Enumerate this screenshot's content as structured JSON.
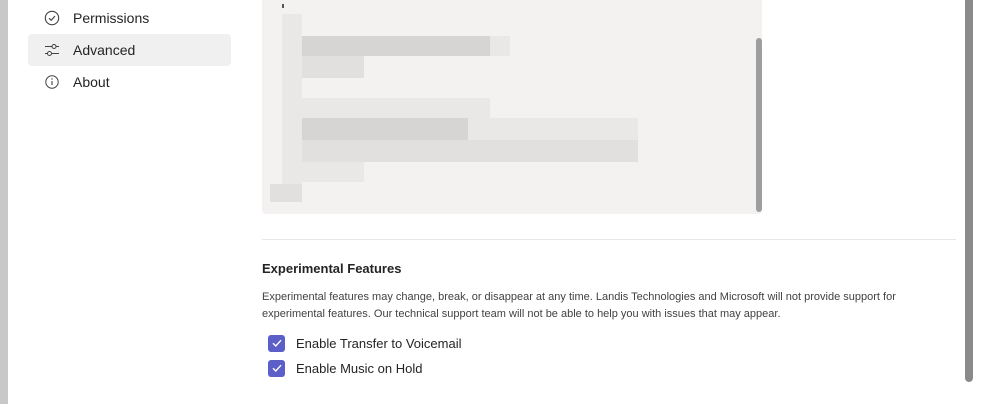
{
  "sidebar": {
    "items": [
      {
        "label": "Permissions",
        "icon": "check-circle-icon",
        "active": false
      },
      {
        "label": "Advanced",
        "icon": "sliders-icon",
        "active": true
      },
      {
        "label": "About",
        "icon": "info-icon",
        "active": false
      }
    ]
  },
  "experimental": {
    "title": "Experimental Features",
    "description": "Experimental features may change, break, or disappear at any time. Landis Technologies and Microsoft will not provide support for experimental features. Our technical support team will not be able to help you with issues that may appear.",
    "options": [
      {
        "label": "Enable Transfer to Voicemail",
        "checked": true
      },
      {
        "label": "Enable Music on Hold",
        "checked": true
      }
    ]
  },
  "colors": {
    "accent": "#5b5fc7",
    "active_nav_bg": "#f0f0f0",
    "code_bg": "#f3f2f1"
  }
}
